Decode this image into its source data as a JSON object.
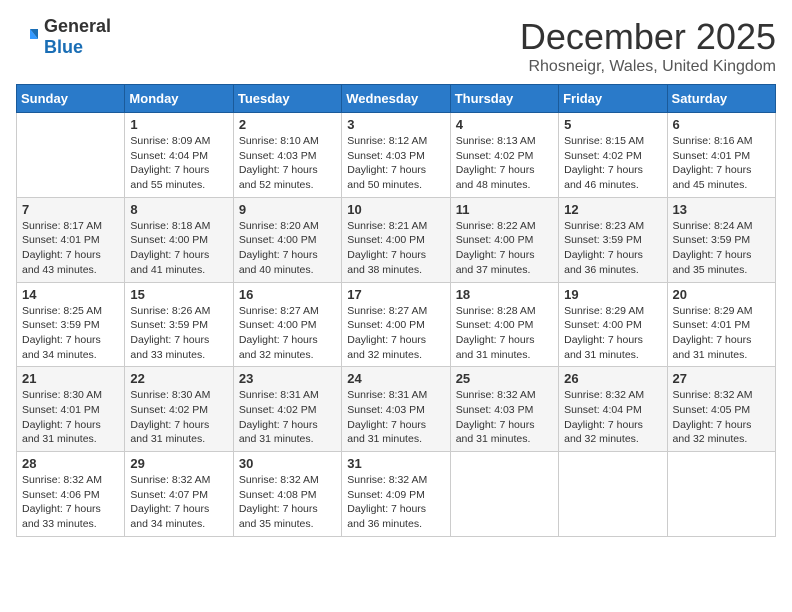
{
  "logo": {
    "general": "General",
    "blue": "Blue"
  },
  "title": "December 2025",
  "location": "Rhosneigr, Wales, United Kingdom",
  "days_of_week": [
    "Sunday",
    "Monday",
    "Tuesday",
    "Wednesday",
    "Thursday",
    "Friday",
    "Saturday"
  ],
  "weeks": [
    [
      {
        "day": "",
        "sunrise": "",
        "sunset": "",
        "daylight": ""
      },
      {
        "day": "1",
        "sunrise": "Sunrise: 8:09 AM",
        "sunset": "Sunset: 4:04 PM",
        "daylight": "Daylight: 7 hours and 55 minutes."
      },
      {
        "day": "2",
        "sunrise": "Sunrise: 8:10 AM",
        "sunset": "Sunset: 4:03 PM",
        "daylight": "Daylight: 7 hours and 52 minutes."
      },
      {
        "day": "3",
        "sunrise": "Sunrise: 8:12 AM",
        "sunset": "Sunset: 4:03 PM",
        "daylight": "Daylight: 7 hours and 50 minutes."
      },
      {
        "day": "4",
        "sunrise": "Sunrise: 8:13 AM",
        "sunset": "Sunset: 4:02 PM",
        "daylight": "Daylight: 7 hours and 48 minutes."
      },
      {
        "day": "5",
        "sunrise": "Sunrise: 8:15 AM",
        "sunset": "Sunset: 4:02 PM",
        "daylight": "Daylight: 7 hours and 46 minutes."
      },
      {
        "day": "6",
        "sunrise": "Sunrise: 8:16 AM",
        "sunset": "Sunset: 4:01 PM",
        "daylight": "Daylight: 7 hours and 45 minutes."
      }
    ],
    [
      {
        "day": "7",
        "sunrise": "Sunrise: 8:17 AM",
        "sunset": "Sunset: 4:01 PM",
        "daylight": "Daylight: 7 hours and 43 minutes."
      },
      {
        "day": "8",
        "sunrise": "Sunrise: 8:18 AM",
        "sunset": "Sunset: 4:00 PM",
        "daylight": "Daylight: 7 hours and 41 minutes."
      },
      {
        "day": "9",
        "sunrise": "Sunrise: 8:20 AM",
        "sunset": "Sunset: 4:00 PM",
        "daylight": "Daylight: 7 hours and 40 minutes."
      },
      {
        "day": "10",
        "sunrise": "Sunrise: 8:21 AM",
        "sunset": "Sunset: 4:00 PM",
        "daylight": "Daylight: 7 hours and 38 minutes."
      },
      {
        "day": "11",
        "sunrise": "Sunrise: 8:22 AM",
        "sunset": "Sunset: 4:00 PM",
        "daylight": "Daylight: 7 hours and 37 minutes."
      },
      {
        "day": "12",
        "sunrise": "Sunrise: 8:23 AM",
        "sunset": "Sunset: 3:59 PM",
        "daylight": "Daylight: 7 hours and 36 minutes."
      },
      {
        "day": "13",
        "sunrise": "Sunrise: 8:24 AM",
        "sunset": "Sunset: 3:59 PM",
        "daylight": "Daylight: 7 hours and 35 minutes."
      }
    ],
    [
      {
        "day": "14",
        "sunrise": "Sunrise: 8:25 AM",
        "sunset": "Sunset: 3:59 PM",
        "daylight": "Daylight: 7 hours and 34 minutes."
      },
      {
        "day": "15",
        "sunrise": "Sunrise: 8:26 AM",
        "sunset": "Sunset: 3:59 PM",
        "daylight": "Daylight: 7 hours and 33 minutes."
      },
      {
        "day": "16",
        "sunrise": "Sunrise: 8:27 AM",
        "sunset": "Sunset: 4:00 PM",
        "daylight": "Daylight: 7 hours and 32 minutes."
      },
      {
        "day": "17",
        "sunrise": "Sunrise: 8:27 AM",
        "sunset": "Sunset: 4:00 PM",
        "daylight": "Daylight: 7 hours and 32 minutes."
      },
      {
        "day": "18",
        "sunrise": "Sunrise: 8:28 AM",
        "sunset": "Sunset: 4:00 PM",
        "daylight": "Daylight: 7 hours and 31 minutes."
      },
      {
        "day": "19",
        "sunrise": "Sunrise: 8:29 AM",
        "sunset": "Sunset: 4:00 PM",
        "daylight": "Daylight: 7 hours and 31 minutes."
      },
      {
        "day": "20",
        "sunrise": "Sunrise: 8:29 AM",
        "sunset": "Sunset: 4:01 PM",
        "daylight": "Daylight: 7 hours and 31 minutes."
      }
    ],
    [
      {
        "day": "21",
        "sunrise": "Sunrise: 8:30 AM",
        "sunset": "Sunset: 4:01 PM",
        "daylight": "Daylight: 7 hours and 31 minutes."
      },
      {
        "day": "22",
        "sunrise": "Sunrise: 8:30 AM",
        "sunset": "Sunset: 4:02 PM",
        "daylight": "Daylight: 7 hours and 31 minutes."
      },
      {
        "day": "23",
        "sunrise": "Sunrise: 8:31 AM",
        "sunset": "Sunset: 4:02 PM",
        "daylight": "Daylight: 7 hours and 31 minutes."
      },
      {
        "day": "24",
        "sunrise": "Sunrise: 8:31 AM",
        "sunset": "Sunset: 4:03 PM",
        "daylight": "Daylight: 7 hours and 31 minutes."
      },
      {
        "day": "25",
        "sunrise": "Sunrise: 8:32 AM",
        "sunset": "Sunset: 4:03 PM",
        "daylight": "Daylight: 7 hours and 31 minutes."
      },
      {
        "day": "26",
        "sunrise": "Sunrise: 8:32 AM",
        "sunset": "Sunset: 4:04 PM",
        "daylight": "Daylight: 7 hours and 32 minutes."
      },
      {
        "day": "27",
        "sunrise": "Sunrise: 8:32 AM",
        "sunset": "Sunset: 4:05 PM",
        "daylight": "Daylight: 7 hours and 32 minutes."
      }
    ],
    [
      {
        "day": "28",
        "sunrise": "Sunrise: 8:32 AM",
        "sunset": "Sunset: 4:06 PM",
        "daylight": "Daylight: 7 hours and 33 minutes."
      },
      {
        "day": "29",
        "sunrise": "Sunrise: 8:32 AM",
        "sunset": "Sunset: 4:07 PM",
        "daylight": "Daylight: 7 hours and 34 minutes."
      },
      {
        "day": "30",
        "sunrise": "Sunrise: 8:32 AM",
        "sunset": "Sunset: 4:08 PM",
        "daylight": "Daylight: 7 hours and 35 minutes."
      },
      {
        "day": "31",
        "sunrise": "Sunrise: 8:32 AM",
        "sunset": "Sunset: 4:09 PM",
        "daylight": "Daylight: 7 hours and 36 minutes."
      },
      {
        "day": "",
        "sunrise": "",
        "sunset": "",
        "daylight": ""
      },
      {
        "day": "",
        "sunrise": "",
        "sunset": "",
        "daylight": ""
      },
      {
        "day": "",
        "sunrise": "",
        "sunset": "",
        "daylight": ""
      }
    ]
  ]
}
